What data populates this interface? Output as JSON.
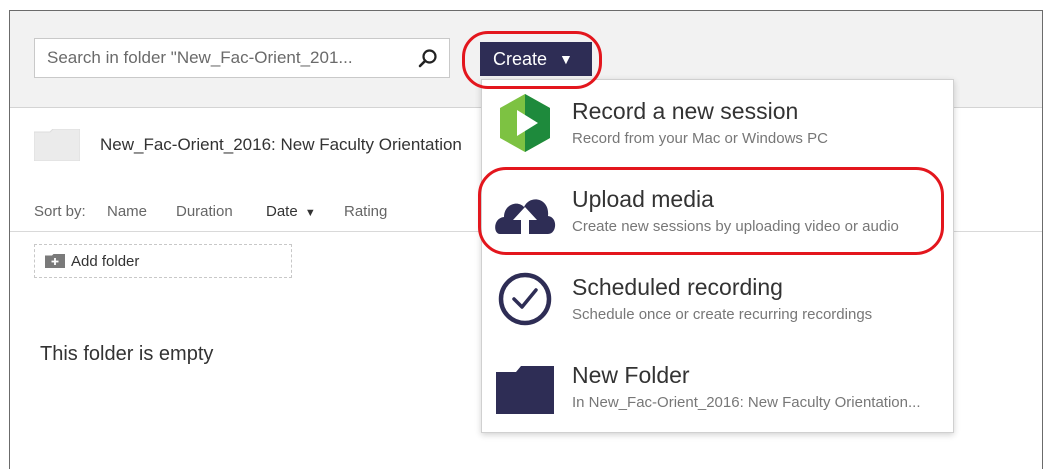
{
  "search": {
    "placeholder": "Search in folder \"New_Fac-Orient_201..."
  },
  "toolbar": {
    "create_label": "Create",
    "create_caret": "▼"
  },
  "folder": {
    "title": "New_Fac-Orient_2016: New Faculty Orientation"
  },
  "sort": {
    "label": "Sort by:",
    "options": [
      "Name",
      "Duration",
      "Date",
      "Rating"
    ],
    "active_caret": "▼"
  },
  "add_folder_label": "Add folder",
  "empty_message": "This folder is empty",
  "create_menu": {
    "items": [
      {
        "title": "Record a new session",
        "subtitle": "Record from your Mac or Windows PC",
        "icon": "panopto-play-icon"
      },
      {
        "title": "Upload media",
        "subtitle": "Create new sessions by uploading video or audio",
        "icon": "cloud-upload-icon"
      },
      {
        "title": "Scheduled recording",
        "subtitle": "Schedule once or create recurring recordings",
        "icon": "clock-icon"
      },
      {
        "title": "New Folder",
        "subtitle": "In New_Fac-Orient_2016: New Faculty Orientation...",
        "icon": "folder-icon"
      }
    ]
  },
  "colors": {
    "accent": "#2e2d55",
    "highlight": "#e3161d",
    "green_light": "#7dc242",
    "green_dark": "#1e8a3c"
  }
}
